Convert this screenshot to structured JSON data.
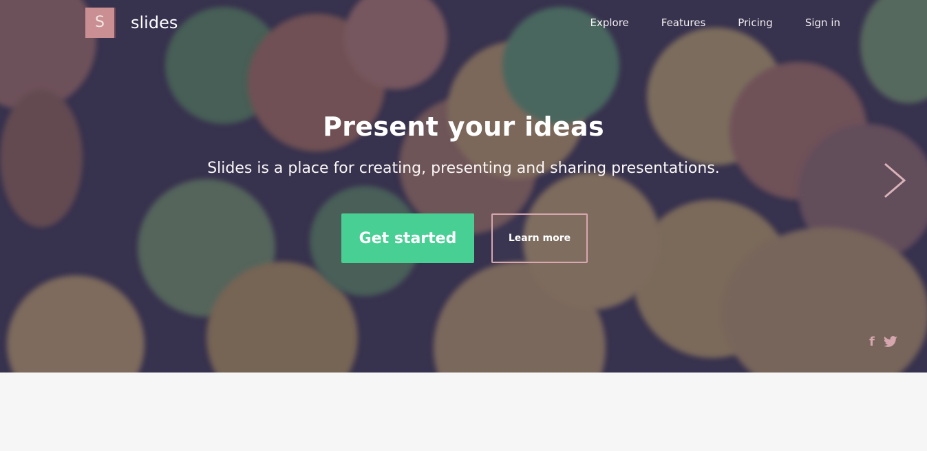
{
  "brand": {
    "logo_letter": "S",
    "name": "slides"
  },
  "nav": {
    "items": [
      {
        "label": "Explore"
      },
      {
        "label": "Features"
      },
      {
        "label": "Pricing"
      },
      {
        "label": "Sign in"
      }
    ]
  },
  "hero": {
    "title": "Present your ideas",
    "subtitle": "Slides is a place for creating, presenting and sharing presentations.",
    "primary_button": "Get started",
    "secondary_button": "Learn more"
  },
  "icons": {
    "next": "chevron-right-icon",
    "facebook": "facebook-icon",
    "twitter": "twitter-icon"
  },
  "colors": {
    "accent_green": "#47cf94",
    "logo_pink": "#c98f92",
    "hero_base": "#3a3550",
    "page_bg": "#f6f6f6"
  }
}
